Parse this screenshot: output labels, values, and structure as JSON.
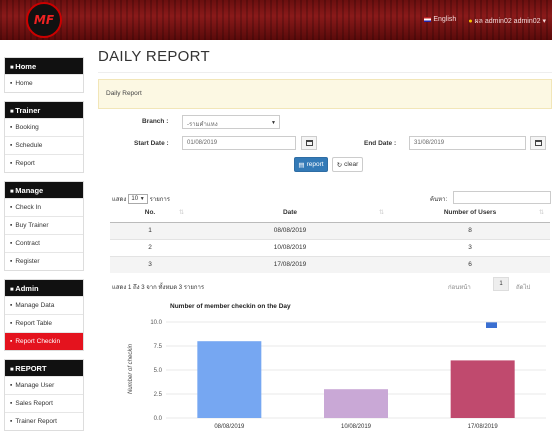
{
  "header": {
    "language": "English",
    "user": "ผล admin02 admin02",
    "logo": "MF"
  },
  "sidebar": {
    "sections": [
      {
        "title": "Home",
        "icon": "home-icon",
        "items": [
          {
            "label": "Home",
            "icon": "home-icon"
          }
        ]
      },
      {
        "title": "Trainer",
        "icon": "gear-icon",
        "items": [
          {
            "label": "Booking",
            "icon": "edit-icon"
          },
          {
            "label": "Schedule",
            "icon": "clock-icon"
          },
          {
            "label": "Report",
            "icon": "file-icon"
          }
        ]
      },
      {
        "title": "Manage",
        "icon": "save-icon",
        "items": [
          {
            "label": "Check In",
            "icon": "check-icon"
          },
          {
            "label": "Buy Trainer",
            "icon": "cart-icon"
          },
          {
            "label": "Contract",
            "icon": "file-icon"
          },
          {
            "label": "Register",
            "icon": "pen-icon"
          }
        ]
      },
      {
        "title": "Admin",
        "icon": "user-icon",
        "items": [
          {
            "label": "Manage Data",
            "icon": "exchange-icon"
          },
          {
            "label": "Report Table",
            "icon": "file-icon"
          },
          {
            "label": "Report Checkin",
            "icon": "file-icon",
            "active": true
          }
        ]
      },
      {
        "title": "REPORT",
        "icon": "file-icon",
        "items": [
          {
            "label": "Manage User",
            "icon": "gear-icon"
          },
          {
            "label": "Sales Report",
            "icon": "file-icon"
          },
          {
            "label": "Trainer Report",
            "icon": "file-icon"
          }
        ]
      }
    ]
  },
  "page": {
    "title": "DAILY REPORT",
    "box_title": "Daily Report"
  },
  "form": {
    "branch_label": "Branch :",
    "branch_value": "-รามคำแหง",
    "start_label": "Start Date :",
    "start_value": "01/08/2019",
    "end_label": "End Date :",
    "end_value": "31/08/2019",
    "report_button": "report",
    "clear_button": "clear"
  },
  "table": {
    "length_prefix": "แสดง",
    "length_value": "10",
    "length_suffix": "รายการ",
    "search_label": "ค้นหา:",
    "columns": [
      "No.",
      "Date",
      "Number of Users"
    ],
    "rows": [
      [
        "1",
        "08/08/2019",
        "8"
      ],
      [
        "2",
        "10/08/2019",
        "3"
      ],
      [
        "3",
        "17/08/2019",
        "6"
      ]
    ],
    "info": "แสดง 1 ถึง 3 จาก ทั้งหมด 3 รายการ",
    "prev": "ก่อนหน้า",
    "page": "1",
    "next": "ถัดไป"
  },
  "chart_data": {
    "type": "bar",
    "title": "Number of member checkin on the Day",
    "ylabel": "Number of checkin",
    "xlabel": "",
    "categories": [
      "08/08/2019",
      "10/08/2019",
      "17/08/2019"
    ],
    "values": [
      8,
      3,
      6
    ],
    "colors": [
      "#76a7f2",
      "#c9a8d6",
      "#c04a6e"
    ],
    "yticks": [
      "10.0",
      "7.5",
      "5.0",
      "2.5",
      "0.0"
    ],
    "ylim": [
      0,
      10
    ],
    "grid": true,
    "legend_color": "#3a6fd1"
  }
}
